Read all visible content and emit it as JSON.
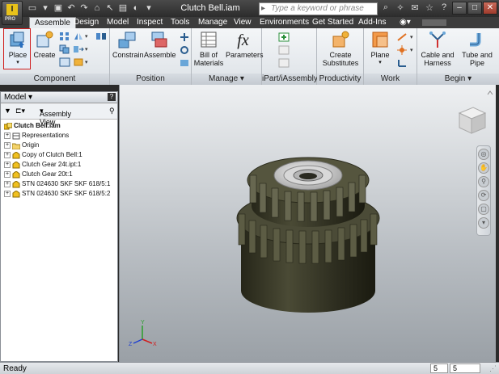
{
  "title_bar": {
    "app_logo": "I",
    "app_edition": "PRO",
    "document_title": "Clutch Bell.iam",
    "search_placeholder": "Type a keyword or phrase",
    "qat_icons": [
      "new-icon",
      "open-icon",
      "save-icon",
      "undo-icon",
      "redo-icon",
      "home-icon",
      "select-icon",
      "properties-icon",
      "material-icon",
      "more-icon"
    ]
  },
  "tabs": [
    "Assemble",
    "Design",
    "Model",
    "Inspect",
    "Tools",
    "Manage",
    "View",
    "Environments",
    "Get Started",
    "Add-Ins"
  ],
  "active_tab": "Assemble",
  "ribbon": {
    "component": {
      "label": "Component",
      "place": "Place",
      "create": "Create"
    },
    "position": {
      "label": "Position",
      "constrain": "Constrain",
      "assemble": "Assemble"
    },
    "manage": {
      "label": "Manage",
      "bill_of_materials_line1": "Bill of",
      "bill_of_materials_line2": "Materials",
      "parameters": "Parameters",
      "parameters_glyph": "fx"
    },
    "ipart": {
      "label": "iPart/iAssembly"
    },
    "productivity": {
      "label": "Productivity",
      "create_substitutes_line1": "Create",
      "create_substitutes_line2": "Substitutes"
    },
    "work_features": {
      "label": "Work Features",
      "plane": "Plane"
    },
    "begin": {
      "label": "Begin",
      "cable_line1": "Cable and",
      "cable_line2": "Harness",
      "tube_line1": "Tube and",
      "tube_line2": "Pipe"
    }
  },
  "model_browser": {
    "title": "Model",
    "view_label": "Assembly View",
    "root": "Clutch Bell.iam",
    "items": [
      {
        "label": "Representations",
        "icon": "representations-icon"
      },
      {
        "label": "Origin",
        "icon": "folder-icon"
      },
      {
        "label": "Copy of Clutch Bell:1",
        "icon": "part-icon"
      },
      {
        "label": "Clutch Gear 24t.ipt:1",
        "icon": "part-icon"
      },
      {
        "label": "Clutch Gear 20t:1",
        "icon": "part-icon"
      },
      {
        "label": "STN 024630 SKF SKF 618/5:1",
        "icon": "part-icon"
      },
      {
        "label": "STN 024630 SKF SKF 618/5:2",
        "icon": "part-icon"
      }
    ]
  },
  "status_bar": {
    "status": "Ready",
    "count1": "5",
    "count2": "5"
  },
  "colors": {
    "ribbon_bg": "#e9ecef",
    "gear_dark": "#3d3d2c",
    "viewport_top": "#eef0f2",
    "viewport_bottom": "#9aa0a6",
    "highlight_red": "#d02020"
  }
}
